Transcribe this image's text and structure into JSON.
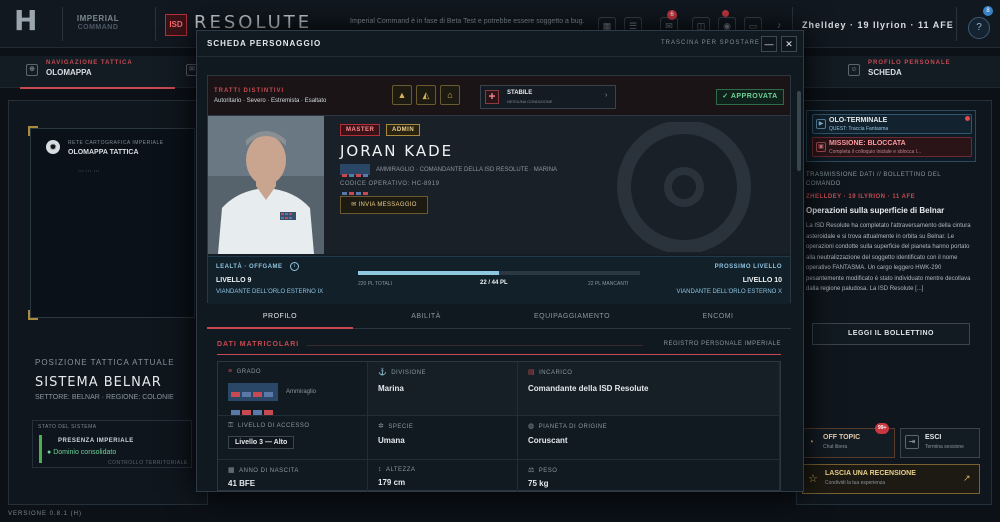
{
  "header": {
    "logo_text": "IMPERIAL",
    "logo_sub": "COMMAND",
    "isd": "ISD",
    "ship": "RESOLUTE",
    "beta": "Imperial Command è in fase di Beta Test e potrebbe essere soggetto a bug.",
    "badge1": "6",
    "badge2": "",
    "date": "Zhelldey · 19 Ilyrion · 11 AFE",
    "help": "?",
    "help_badge": "8"
  },
  "nav": {
    "tab1_l1": "NAVIGAZIONE TATTICA",
    "tab1_l2": "OLOMAPPA",
    "tab2_l1": "PROFILO PERSONALE",
    "tab2_l2": "SCHEDA"
  },
  "left": {
    "map_l1": "RETE CARTOGRAFICA IMPERIALE",
    "map_l2": "OLOMAPPA TATTICA",
    "pos_lbl": "POSIZIONE TATTICA ATTUALE",
    "sys": "SISTEMA BELNAR",
    "settore": "SETTORE: BELNAR · REGIONE: COLONIE",
    "stato_lbl": "STATO DEL SISTEMA",
    "presenza": "PRESENZA IMPERIALE",
    "dominio": "Dominio consolidato",
    "controllo": "CONTROLLO TERRITORIALE",
    "version": "VERSIONE 0.8.1 (H)"
  },
  "right": {
    "holo_title": "OLO-TERMINALE",
    "holo_sub": "QUEST: Traccia Fantasma",
    "miss_title": "MISSIONE: BLOCCATA",
    "miss_sub": "Completa il colloquio iniziale e sblocca l...",
    "bull_lbl": "TRASMISSIONE DATI // BOLLETTINO DEL COMANDO",
    "bull_date": "ZHELLDEY · 19 ILYRION · 11 AFE",
    "bull_title": "Operazioni sulla superficie di Belnar",
    "bull_text": "La ISD Resolute ha completato l'attraversamento della cintura asteroidale e si trova attualmente in orbita su Belnar. Le operazioni condotte sulla superficie del pianeta hanno portato alla neutralizzazione del soggetto identificato con il nome operativo FANTASMA. Un cargo leggero HWK-290 pesantemente modificato è stato individuato mentre decollava dalla regione paludosa. La ISD Resolute [...]",
    "leggi": "LEGGI IL BOLLETTINO",
    "off": "OFF TOPIC",
    "off_sub": "Chat libera",
    "off_badge": "99+",
    "esci": "ESCI",
    "esci_sub": "Termina sessione",
    "lascia": "LASCIA UNA RECENSIONE",
    "lascia_sub": "Condividi la tua esperienza"
  },
  "modal": {
    "title": "SCHEDA PERSONAGGIO",
    "drag": "TRASCINA PER SPOSTARE",
    "min": "—",
    "close": "✕",
    "tratti_lbl": "TRATTI DISTINTIVI",
    "tratti": "Autoritario · Severo · Estremista · Esaltato",
    "stabile": "STABILE",
    "stabile_sub": "NESSUNA CONDIZIONE",
    "approv": "✓ APPROVATA",
    "tag_master": "MASTER",
    "tag_admin": "ADMIN",
    "name": "JORAN KADE",
    "role": "AMMIRAGLIO · COMANDANTE DELLA ISD RESOLUTE · MARINA",
    "code": "CODICE OPERATIVO: HC-8919",
    "msg": "✉ INVIA MESSAGGIO",
    "lealta_lbl": "LEALTÀ · OFFGAME",
    "lvl": "LIVELLO 9",
    "viand": "VIANDANTE DELL'ORLO ESTERNO IX",
    "pl_tot": "220 PL TOTALI",
    "pl_cur": "22 / 44 PL",
    "pl_miss": "22 PL MANCANTI",
    "progress": 0.5,
    "next_lbl": "PROSSIMO LIVELLO",
    "next_lvl": "LIVELLO 10",
    "next_viand": "VIANDANTE DELL'ORLO ESTERNO X",
    "tabs": [
      "PROFILO",
      "ABILITÀ",
      "EQUIPAGGIAMENTO",
      "ENCOMI"
    ],
    "dati": "DATI MATRICOLARI",
    "registro": "REGISTRO PERSONALE IMPERIALE",
    "grado_lbl": "GRADO",
    "grado": "Ammiraglio",
    "div_lbl": "DIVISIONE",
    "div": "Marina",
    "inc_lbl": "INCARICO",
    "inc": "Comandante della ISD Resolute",
    "acc_lbl": "LIVELLO DI ACCESSO",
    "acc": "Livello 3 — Alto",
    "spec_lbl": "SPECIE",
    "spec": "Umana",
    "pian_lbl": "PIANETA DI ORIGINE",
    "pian": "Coruscant",
    "nasc_lbl": "ANNO DI NASCITA",
    "nasc": "41 BFE",
    "alt_lbl": "ALTEZZA",
    "alt": "179 cm",
    "peso_lbl": "PESO",
    "peso": "75 kg"
  }
}
